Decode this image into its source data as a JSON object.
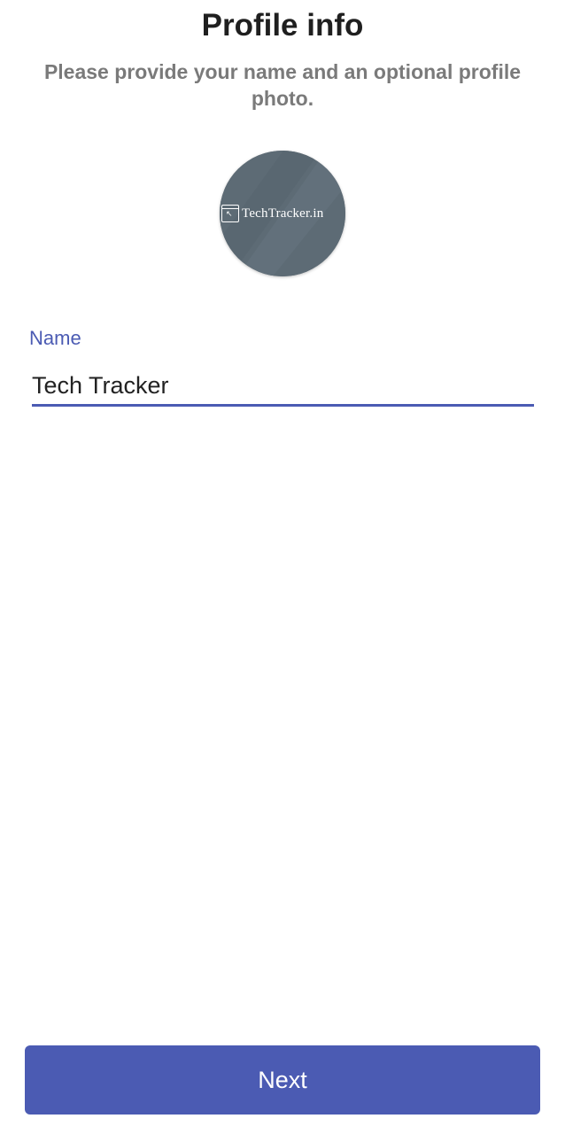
{
  "page": {
    "title": "Profile info",
    "subtitle": "Please provide your name and an optional profile photo."
  },
  "avatar": {
    "logo_text": "TechTracker.in",
    "background_color": "#5d6b75",
    "icon": "browser-cursor-icon"
  },
  "name_field": {
    "label": "Name",
    "value": "Tech Tracker",
    "accent_color": "#4b5bb3"
  },
  "actions": {
    "next_label": "Next",
    "button_color": "#4b5bb3"
  }
}
